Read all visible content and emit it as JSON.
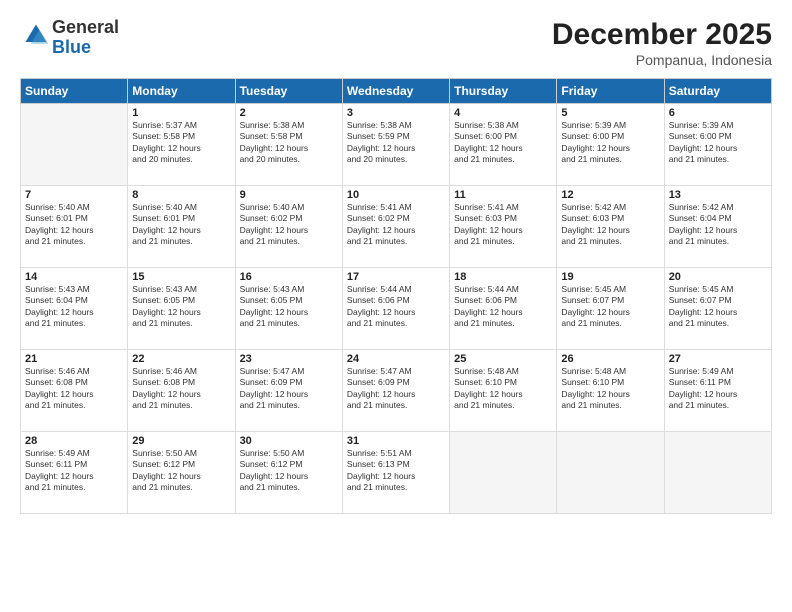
{
  "logo": {
    "general": "General",
    "blue": "Blue"
  },
  "title": "December 2025",
  "subtitle": "Pompanua, Indonesia",
  "days_header": [
    "Sunday",
    "Monday",
    "Tuesday",
    "Wednesday",
    "Thursday",
    "Friday",
    "Saturday"
  ],
  "weeks": [
    [
      {
        "num": "",
        "info": ""
      },
      {
        "num": "1",
        "info": "Sunrise: 5:37 AM\nSunset: 5:58 PM\nDaylight: 12 hours\nand 20 minutes."
      },
      {
        "num": "2",
        "info": "Sunrise: 5:38 AM\nSunset: 5:58 PM\nDaylight: 12 hours\nand 20 minutes."
      },
      {
        "num": "3",
        "info": "Sunrise: 5:38 AM\nSunset: 5:59 PM\nDaylight: 12 hours\nand 20 minutes."
      },
      {
        "num": "4",
        "info": "Sunrise: 5:38 AM\nSunset: 6:00 PM\nDaylight: 12 hours\nand 21 minutes."
      },
      {
        "num": "5",
        "info": "Sunrise: 5:39 AM\nSunset: 6:00 PM\nDaylight: 12 hours\nand 21 minutes."
      },
      {
        "num": "6",
        "info": "Sunrise: 5:39 AM\nSunset: 6:00 PM\nDaylight: 12 hours\nand 21 minutes."
      }
    ],
    [
      {
        "num": "7",
        "info": "Sunrise: 5:40 AM\nSunset: 6:01 PM\nDaylight: 12 hours\nand 21 minutes."
      },
      {
        "num": "8",
        "info": "Sunrise: 5:40 AM\nSunset: 6:01 PM\nDaylight: 12 hours\nand 21 minutes."
      },
      {
        "num": "9",
        "info": "Sunrise: 5:40 AM\nSunset: 6:02 PM\nDaylight: 12 hours\nand 21 minutes."
      },
      {
        "num": "10",
        "info": "Sunrise: 5:41 AM\nSunset: 6:02 PM\nDaylight: 12 hours\nand 21 minutes."
      },
      {
        "num": "11",
        "info": "Sunrise: 5:41 AM\nSunset: 6:03 PM\nDaylight: 12 hours\nand 21 minutes."
      },
      {
        "num": "12",
        "info": "Sunrise: 5:42 AM\nSunset: 6:03 PM\nDaylight: 12 hours\nand 21 minutes."
      },
      {
        "num": "13",
        "info": "Sunrise: 5:42 AM\nSunset: 6:04 PM\nDaylight: 12 hours\nand 21 minutes."
      }
    ],
    [
      {
        "num": "14",
        "info": "Sunrise: 5:43 AM\nSunset: 6:04 PM\nDaylight: 12 hours\nand 21 minutes."
      },
      {
        "num": "15",
        "info": "Sunrise: 5:43 AM\nSunset: 6:05 PM\nDaylight: 12 hours\nand 21 minutes."
      },
      {
        "num": "16",
        "info": "Sunrise: 5:43 AM\nSunset: 6:05 PM\nDaylight: 12 hours\nand 21 minutes."
      },
      {
        "num": "17",
        "info": "Sunrise: 5:44 AM\nSunset: 6:06 PM\nDaylight: 12 hours\nand 21 minutes."
      },
      {
        "num": "18",
        "info": "Sunrise: 5:44 AM\nSunset: 6:06 PM\nDaylight: 12 hours\nand 21 minutes."
      },
      {
        "num": "19",
        "info": "Sunrise: 5:45 AM\nSunset: 6:07 PM\nDaylight: 12 hours\nand 21 minutes."
      },
      {
        "num": "20",
        "info": "Sunrise: 5:45 AM\nSunset: 6:07 PM\nDaylight: 12 hours\nand 21 minutes."
      }
    ],
    [
      {
        "num": "21",
        "info": "Sunrise: 5:46 AM\nSunset: 6:08 PM\nDaylight: 12 hours\nand 21 minutes."
      },
      {
        "num": "22",
        "info": "Sunrise: 5:46 AM\nSunset: 6:08 PM\nDaylight: 12 hours\nand 21 minutes."
      },
      {
        "num": "23",
        "info": "Sunrise: 5:47 AM\nSunset: 6:09 PM\nDaylight: 12 hours\nand 21 minutes."
      },
      {
        "num": "24",
        "info": "Sunrise: 5:47 AM\nSunset: 6:09 PM\nDaylight: 12 hours\nand 21 minutes."
      },
      {
        "num": "25",
        "info": "Sunrise: 5:48 AM\nSunset: 6:10 PM\nDaylight: 12 hours\nand 21 minutes."
      },
      {
        "num": "26",
        "info": "Sunrise: 5:48 AM\nSunset: 6:10 PM\nDaylight: 12 hours\nand 21 minutes."
      },
      {
        "num": "27",
        "info": "Sunrise: 5:49 AM\nSunset: 6:11 PM\nDaylight: 12 hours\nand 21 minutes."
      }
    ],
    [
      {
        "num": "28",
        "info": "Sunrise: 5:49 AM\nSunset: 6:11 PM\nDaylight: 12 hours\nand 21 minutes."
      },
      {
        "num": "29",
        "info": "Sunrise: 5:50 AM\nSunset: 6:12 PM\nDaylight: 12 hours\nand 21 minutes."
      },
      {
        "num": "30",
        "info": "Sunrise: 5:50 AM\nSunset: 6:12 PM\nDaylight: 12 hours\nand 21 minutes."
      },
      {
        "num": "31",
        "info": "Sunrise: 5:51 AM\nSunset: 6:13 PM\nDaylight: 12 hours\nand 21 minutes."
      },
      {
        "num": "",
        "info": ""
      },
      {
        "num": "",
        "info": ""
      },
      {
        "num": "",
        "info": ""
      }
    ]
  ]
}
